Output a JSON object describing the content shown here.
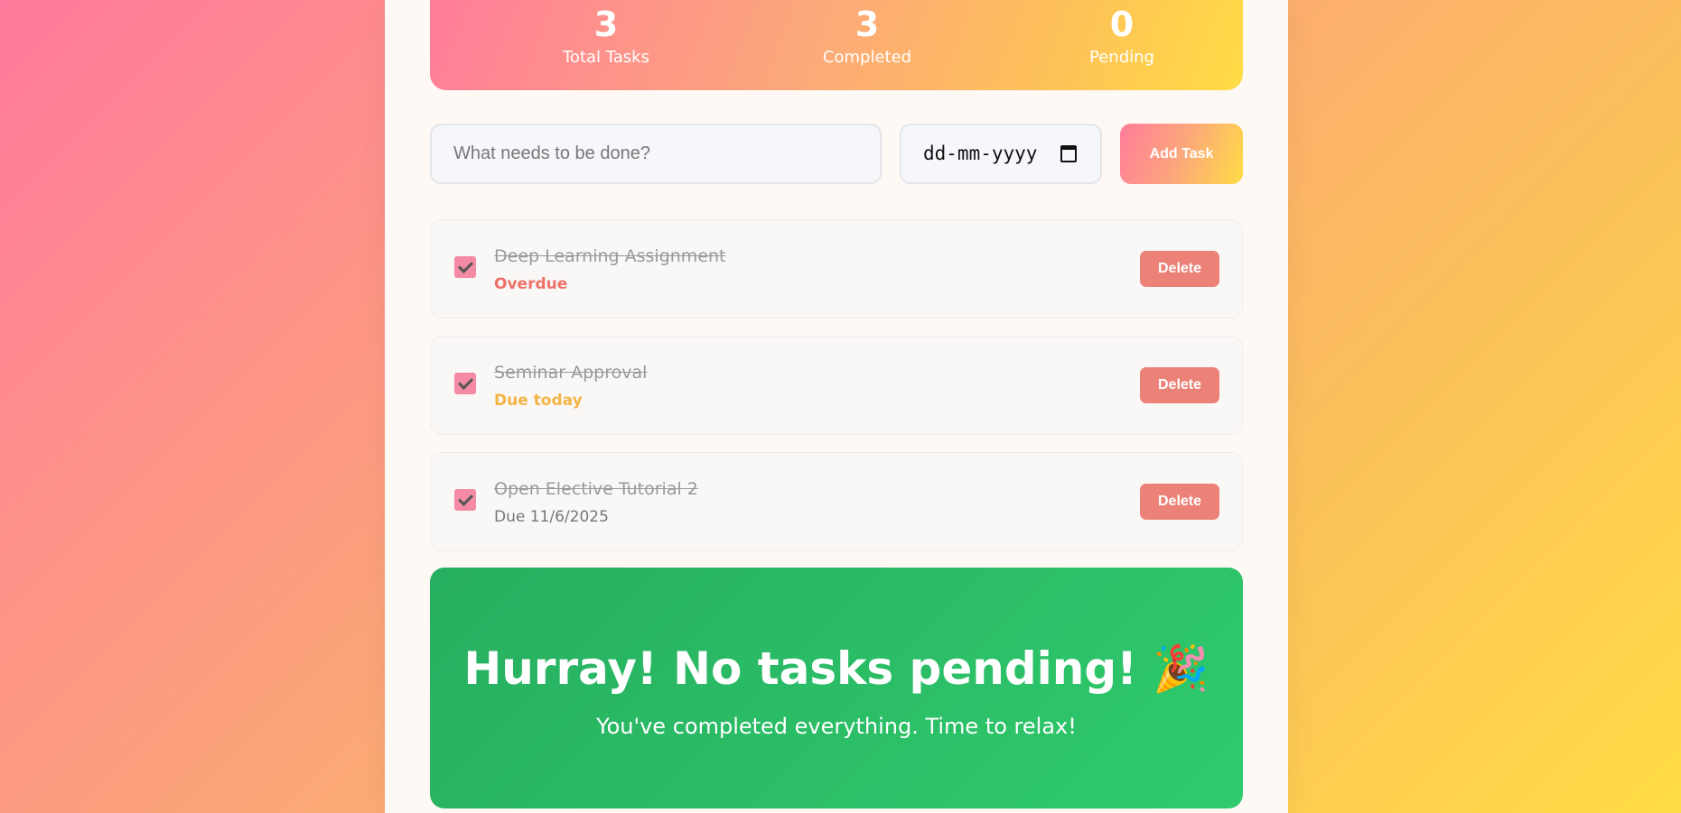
{
  "stats": {
    "total_value": "3",
    "total_label": "Total Tasks",
    "completed_value": "3",
    "completed_label": "Completed",
    "pending_value": "0",
    "pending_label": "Pending"
  },
  "form": {
    "task_placeholder": "What needs to be done?",
    "date_placeholder": "dd-mm-yyyy",
    "add_label": "Add Task"
  },
  "tasks": [
    {
      "title": "Deep Learning Assignment",
      "due": "Overdue",
      "completed": true,
      "delete_label": "Delete"
    },
    {
      "title": "Seminar Approval",
      "due": "Due today",
      "completed": true,
      "delete_label": "Delete"
    },
    {
      "title": "Open Elective Tutorial 2",
      "due": "Due 11/6/2025",
      "completed": true,
      "delete_label": "Delete"
    }
  ],
  "banner": {
    "title": "Hurray! No tasks pending! 🎉",
    "subtitle": "You've completed everything. Time to relax!"
  },
  "colors": {
    "accent_pink": "#ff7d9a",
    "accent_yellow": "#ffdc45",
    "overdue": "#ec7168",
    "due_today": "#f3b545",
    "success_green": "#2fcb6c"
  }
}
